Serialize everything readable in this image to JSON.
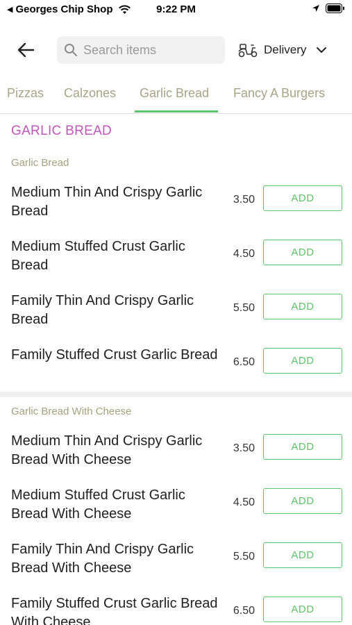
{
  "status_bar": {
    "back_app": "Georges Chip Shop",
    "time": "9:22 PM"
  },
  "header": {
    "search_placeholder": "Search items",
    "delivery_label": "Delivery"
  },
  "tabs": [
    {
      "label": "Pizzas",
      "active": false
    },
    {
      "label": "Calzones",
      "active": false
    },
    {
      "label": "Garlic Bread",
      "active": true
    },
    {
      "label": "Fancy A Burgers",
      "active": false
    }
  ],
  "menu": {
    "section_title": "GARLIC BREAD",
    "add_label": "ADD",
    "groups": [
      {
        "title": "Garlic Bread",
        "items": [
          {
            "name": "Medium Thin And Crispy Garlic Bread",
            "price": "3.50"
          },
          {
            "name": "Medium Stuffed Crust Garlic Bread",
            "price": "4.50"
          },
          {
            "name": "Family Thin And Crispy Garlic Bread",
            "price": "5.50"
          },
          {
            "name": "Family Stuffed Crust Garlic Bread",
            "price": "6.50"
          }
        ]
      },
      {
        "title": "Garlic Bread With Cheese",
        "items": [
          {
            "name": "Medium Thin And Crispy Garlic Bread With Cheese",
            "price": "3.50"
          },
          {
            "name": "Medium Stuffed Crust Garlic Bread With Cheese",
            "price": "4.50"
          },
          {
            "name": "Family Thin And Crispy Garlic Bread With Cheese",
            "price": "5.50"
          },
          {
            "name": "Family Stuffed Crust Garlic Bread With Cheese",
            "price": "6.50"
          }
        ]
      }
    ]
  },
  "colors": {
    "accent_green": "#5cc46b",
    "section_title": "#c056b9",
    "group_title": "#a5a27f"
  },
  "icons": {
    "back": "arrow-left-icon",
    "search": "search-icon",
    "delivery": "scooter-icon",
    "dropdown": "chevron-down-icon",
    "wifi": "wifi-icon",
    "location": "location-arrow-icon",
    "battery": "battery-icon"
  }
}
